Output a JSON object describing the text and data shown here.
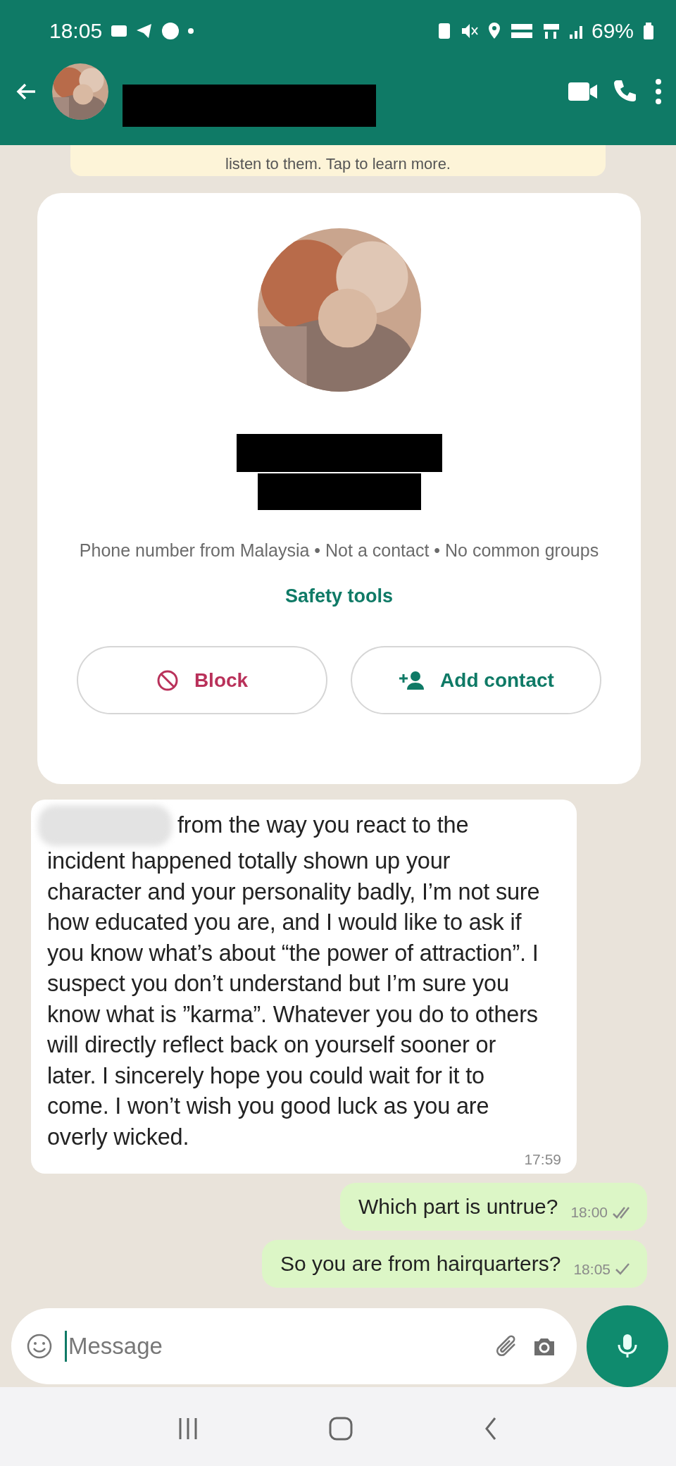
{
  "status_bar": {
    "time": "18:05",
    "battery": "69%"
  },
  "banner": {
    "text": "listen to them. Tap to learn more."
  },
  "contact_card": {
    "details": "Phone number from Malaysia • Not a contact • No common groups",
    "link": "Safety tools",
    "buttons": [
      {
        "label": "Block",
        "kind": "block"
      },
      {
        "label": "Add contact",
        "kind": "add"
      }
    ]
  },
  "messages": [
    {
      "kind": "incoming",
      "first_line": "from the way you react to the",
      "text": "incident happened totally shown up your character and your personality badly, I’m not sure how educated you are, and I would like to ask if you know what’s about “the power of attraction”. I suspect you don’t understand but I’m sure you know what is ”karma”. Whatever you do to others will directly reflect back on yourself sooner or later. I sincerely hope you could wait for it to come. I won’t wish you good luck as you are overly wicked.",
      "time": "17:59"
    },
    {
      "kind": "outgoing",
      "text": "Which part is untrue?",
      "time": "18:00",
      "delivered": true
    },
    {
      "kind": "outgoing",
      "text": "So you are from hairquarters?",
      "time": "18:05",
      "delivered": false
    }
  ],
  "composer": {
    "placeholder": "Message"
  }
}
